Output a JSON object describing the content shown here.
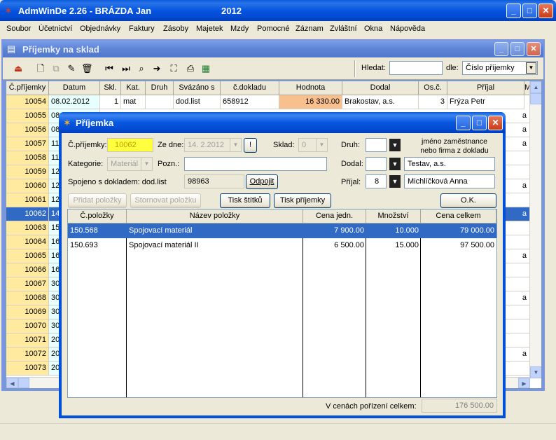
{
  "app": {
    "title": "AdmWinDe 2.26 - BRÁZDA Jan",
    "year": "2012",
    "menu": [
      "Soubor",
      "Účetnictví",
      "Objednávky",
      "Faktury",
      "Zásoby",
      "Majetek",
      "Mzdy",
      "Pomocné",
      "Záznam",
      "Zvláštní",
      "Okna",
      "Nápověda"
    ]
  },
  "child": {
    "title": "Příjemky na sklad",
    "search_label": "Hledat:",
    "search_value": "",
    "by_label": "dle:",
    "by_value": "Číslo příjemky"
  },
  "grid": {
    "columns": [
      "Č.příjemky",
      "Datum",
      "Skl.",
      "Kat.",
      "Druh",
      "Svázáno s",
      "č.dokladu",
      "Hodnota",
      "Dodal",
      "Os.č.",
      "Příjal",
      "M"
    ],
    "first_row": {
      "cislo": "10054",
      "datum": "08.02.2012",
      "skl": "1",
      "kat": "mat",
      "druh": "",
      "svazano": "dod.list",
      "doklad": "658912",
      "hodnota": "16 330.00",
      "dodal": "Brakostav, a.s.",
      "osc": "3",
      "prijal": "Frýza Petr"
    },
    "rows": [
      {
        "cislo": "10055",
        "datum": "08",
        "right": "a"
      },
      {
        "cislo": "10056",
        "datum": "08",
        "right": "a"
      },
      {
        "cislo": "10057",
        "datum": "11",
        "right": "a"
      },
      {
        "cislo": "10058",
        "datum": "11",
        "right": ""
      },
      {
        "cislo": "10059",
        "datum": "12",
        "right": ""
      },
      {
        "cislo": "10060",
        "datum": "12",
        "right": "a"
      },
      {
        "cislo": "10061",
        "datum": "12",
        "right": ""
      },
      {
        "cislo": "10062",
        "datum": "14",
        "right": "a"
      },
      {
        "cislo": "10063",
        "datum": "15",
        "right": ""
      },
      {
        "cislo": "10064",
        "datum": "16",
        "right": ""
      },
      {
        "cislo": "10065",
        "datum": "16",
        "right": "a"
      },
      {
        "cislo": "10066",
        "datum": "16",
        "right": ""
      },
      {
        "cislo": "10067",
        "datum": "30",
        "right": ""
      },
      {
        "cislo": "10068",
        "datum": "30",
        "right": "a"
      },
      {
        "cislo": "10069",
        "datum": "30",
        "right": ""
      },
      {
        "cislo": "10070",
        "datum": "30",
        "right": ""
      },
      {
        "cislo": "10071",
        "datum": "20",
        "right": ""
      },
      {
        "cislo": "10072",
        "datum": "20",
        "right": "a"
      },
      {
        "cislo": "10073",
        "datum": "20",
        "right": ""
      }
    ],
    "selected_index": 7
  },
  "dialog": {
    "title": "Příjemka",
    "cislo_label": "Č.příjemky:",
    "cislo_value": "10062",
    "ze_dne_label": "Ze dne:",
    "ze_dne_value": "14. 2.2012",
    "excl": "!",
    "sklad_label": "Sklad:",
    "sklad_value": "0",
    "druh_label": "Druh:",
    "druh_value": "",
    "hint": "jméno zaměstnance\nnebo firma z dokladu",
    "kategorie_label": "Kategorie:",
    "kategorie_value": "Materiál",
    "pozn_label": "Pozn.:",
    "pozn_value": "",
    "dodal_label": "Dodal:",
    "dodal_code": "",
    "dodal_name": "Testav, a.s.",
    "spojeno_label": "Spojeno s dokladem: dod.list",
    "spojeno_value": "98963",
    "odpojit": "Odpojit",
    "prijal_label": "Příjal:",
    "prijal_code": "8",
    "prijal_name": "Michlíčková Anna",
    "btn_pridat": "Přidat položky",
    "btn_stornovat": "Stornovat položku",
    "btn_tisk_stitku": "Tisk štítků",
    "btn_tisk_prijemky": "Tisk příjemky",
    "btn_ok": "O.K.",
    "items_columns": [
      "Č.položky",
      "Název položky",
      "Cena jedn.",
      "Množství",
      "Cena celkem"
    ],
    "items": [
      {
        "cislo": "150.568",
        "nazev": "Spojovací materiál",
        "cena": "7 900.00",
        "mnozstvi": "10.000",
        "celkem": "79 000.00"
      },
      {
        "cislo": "150.693",
        "nazev": "Spojovací materiál II",
        "cena": "6 500.00",
        "mnozstvi": "15.000",
        "celkem": "97 500.00"
      }
    ],
    "total_label": "V cenách pořízení celkem:",
    "total_value": "176 500.00"
  },
  "colors": {
    "accent": "#0050d8",
    "row_highlight": "#ffeaa0",
    "selection": "#316ac5",
    "value_cell": "#f9c08f"
  }
}
